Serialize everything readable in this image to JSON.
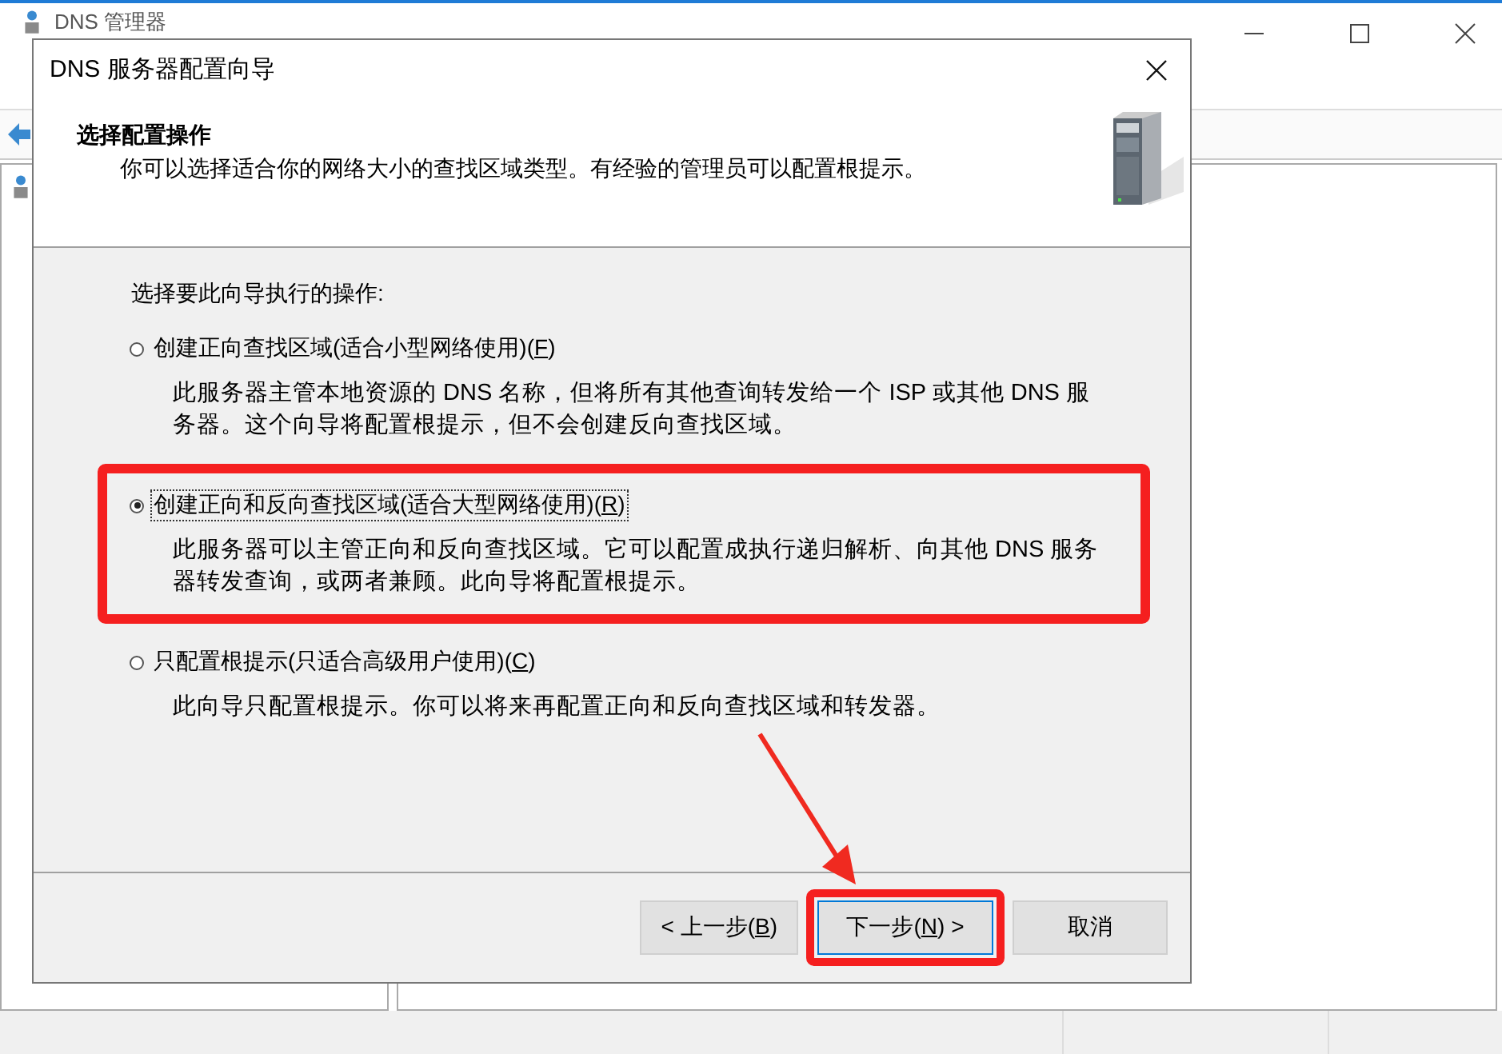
{
  "background_window": {
    "title": "DNS 管理器"
  },
  "dialog": {
    "title": "DNS 服务器配置向导",
    "header": {
      "heading": "选择配置操作",
      "subtitle": "你可以选择适合你的网络大小的查找区域类型。有经验的管理员可以配置根提示。"
    },
    "prompt": "选择要此向导执行的操作:",
    "options": [
      {
        "label": [
          "创建正向查找区域(适合小型网络使用)(",
          "F",
          ")"
        ],
        "description": "此服务器主管本地资源的 DNS 名称，但将所有其他查询转发给一个 ISP 或其他 DNS 服务器。这个向导将配置根提示，但不会创建反向查找区域。",
        "selected": false,
        "highlighted": false
      },
      {
        "label": [
          "创建正向和反向查找区域(适合大型网络使用)(",
          "R",
          ")"
        ],
        "description": "此服务器可以主管正向和反向查找区域。它可以配置成执行递归解析、向其他 DNS 服务器转发查询，或两者兼顾。此向导将配置根提示。",
        "selected": true,
        "highlighted": true
      },
      {
        "label": [
          "只配置根提示(只适合高级用户使用)(",
          "C",
          ")"
        ],
        "description": "此向导只配置根提示。你可以将来再配置正向和反向查找区域和转发器。",
        "selected": false,
        "highlighted": false
      }
    ],
    "buttons": [
      {
        "label": [
          "< 上一步(",
          "B",
          ")"
        ],
        "default": false,
        "highlighted": false
      },
      {
        "label": [
          "下一步(",
          "N",
          ") >"
        ],
        "default": true,
        "highlighted": true
      },
      {
        "label": [
          "取消"
        ],
        "default": false,
        "highlighted": false
      }
    ]
  }
}
